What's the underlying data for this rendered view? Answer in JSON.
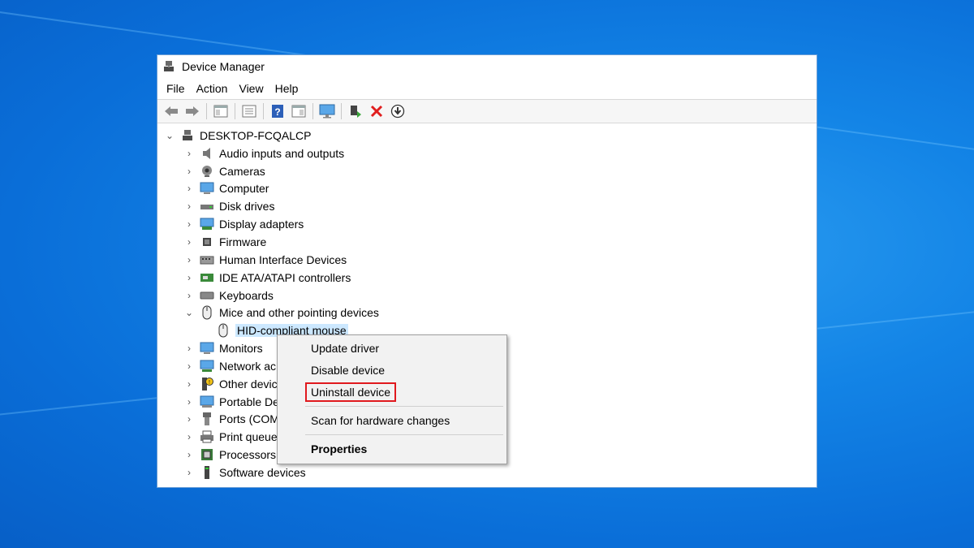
{
  "window": {
    "title": "Device Manager"
  },
  "menu": [
    "File",
    "Action",
    "View",
    "Help"
  ],
  "toolbar": [
    "back-icon",
    "forward-icon",
    "properties-pane-icon",
    "list-icon",
    "help-icon",
    "details-icon",
    "monitor-icon",
    "update-driver-icon",
    "uninstall-icon",
    "download-icon"
  ],
  "tree": {
    "root": "DESKTOP-FCQALCP",
    "categories": [
      {
        "label": "Audio inputs and outputs",
        "icon": "speaker-icon"
      },
      {
        "label": "Cameras",
        "icon": "camera-icon"
      },
      {
        "label": "Computer",
        "icon": "computer-icon"
      },
      {
        "label": "Disk drives",
        "icon": "disk-icon"
      },
      {
        "label": "Display adapters",
        "icon": "display-adapter-icon"
      },
      {
        "label": "Firmware",
        "icon": "chip-icon"
      },
      {
        "label": "Human Interface Devices",
        "icon": "hid-icon"
      },
      {
        "label": "IDE ATA/ATAPI controllers",
        "icon": "controller-icon"
      },
      {
        "label": "Keyboards",
        "icon": "keyboard-icon"
      },
      {
        "label": "Mice and other pointing devices",
        "icon": "mouse-icon",
        "expanded": true
      }
    ],
    "child": "HID-compliant mouse",
    "categories_after": [
      {
        "label": "Monitors",
        "icon": "monitor-icon"
      },
      {
        "label": "Network ac",
        "icon": "network-icon"
      },
      {
        "label": "Other devic",
        "icon": "other-device-icon"
      },
      {
        "label": "Portable De",
        "icon": "portable-icon"
      },
      {
        "label": "Ports (COM",
        "icon": "port-icon"
      },
      {
        "label": "Print queue",
        "icon": "printer-icon"
      },
      {
        "label": "Processors",
        "icon": "processor-icon"
      },
      {
        "label": "Software devices",
        "icon": "software-icon"
      }
    ]
  },
  "context_menu": {
    "update": "Update driver",
    "disable": "Disable device",
    "uninstall": "Uninstall device",
    "scan": "Scan for hardware changes",
    "properties": "Properties"
  }
}
